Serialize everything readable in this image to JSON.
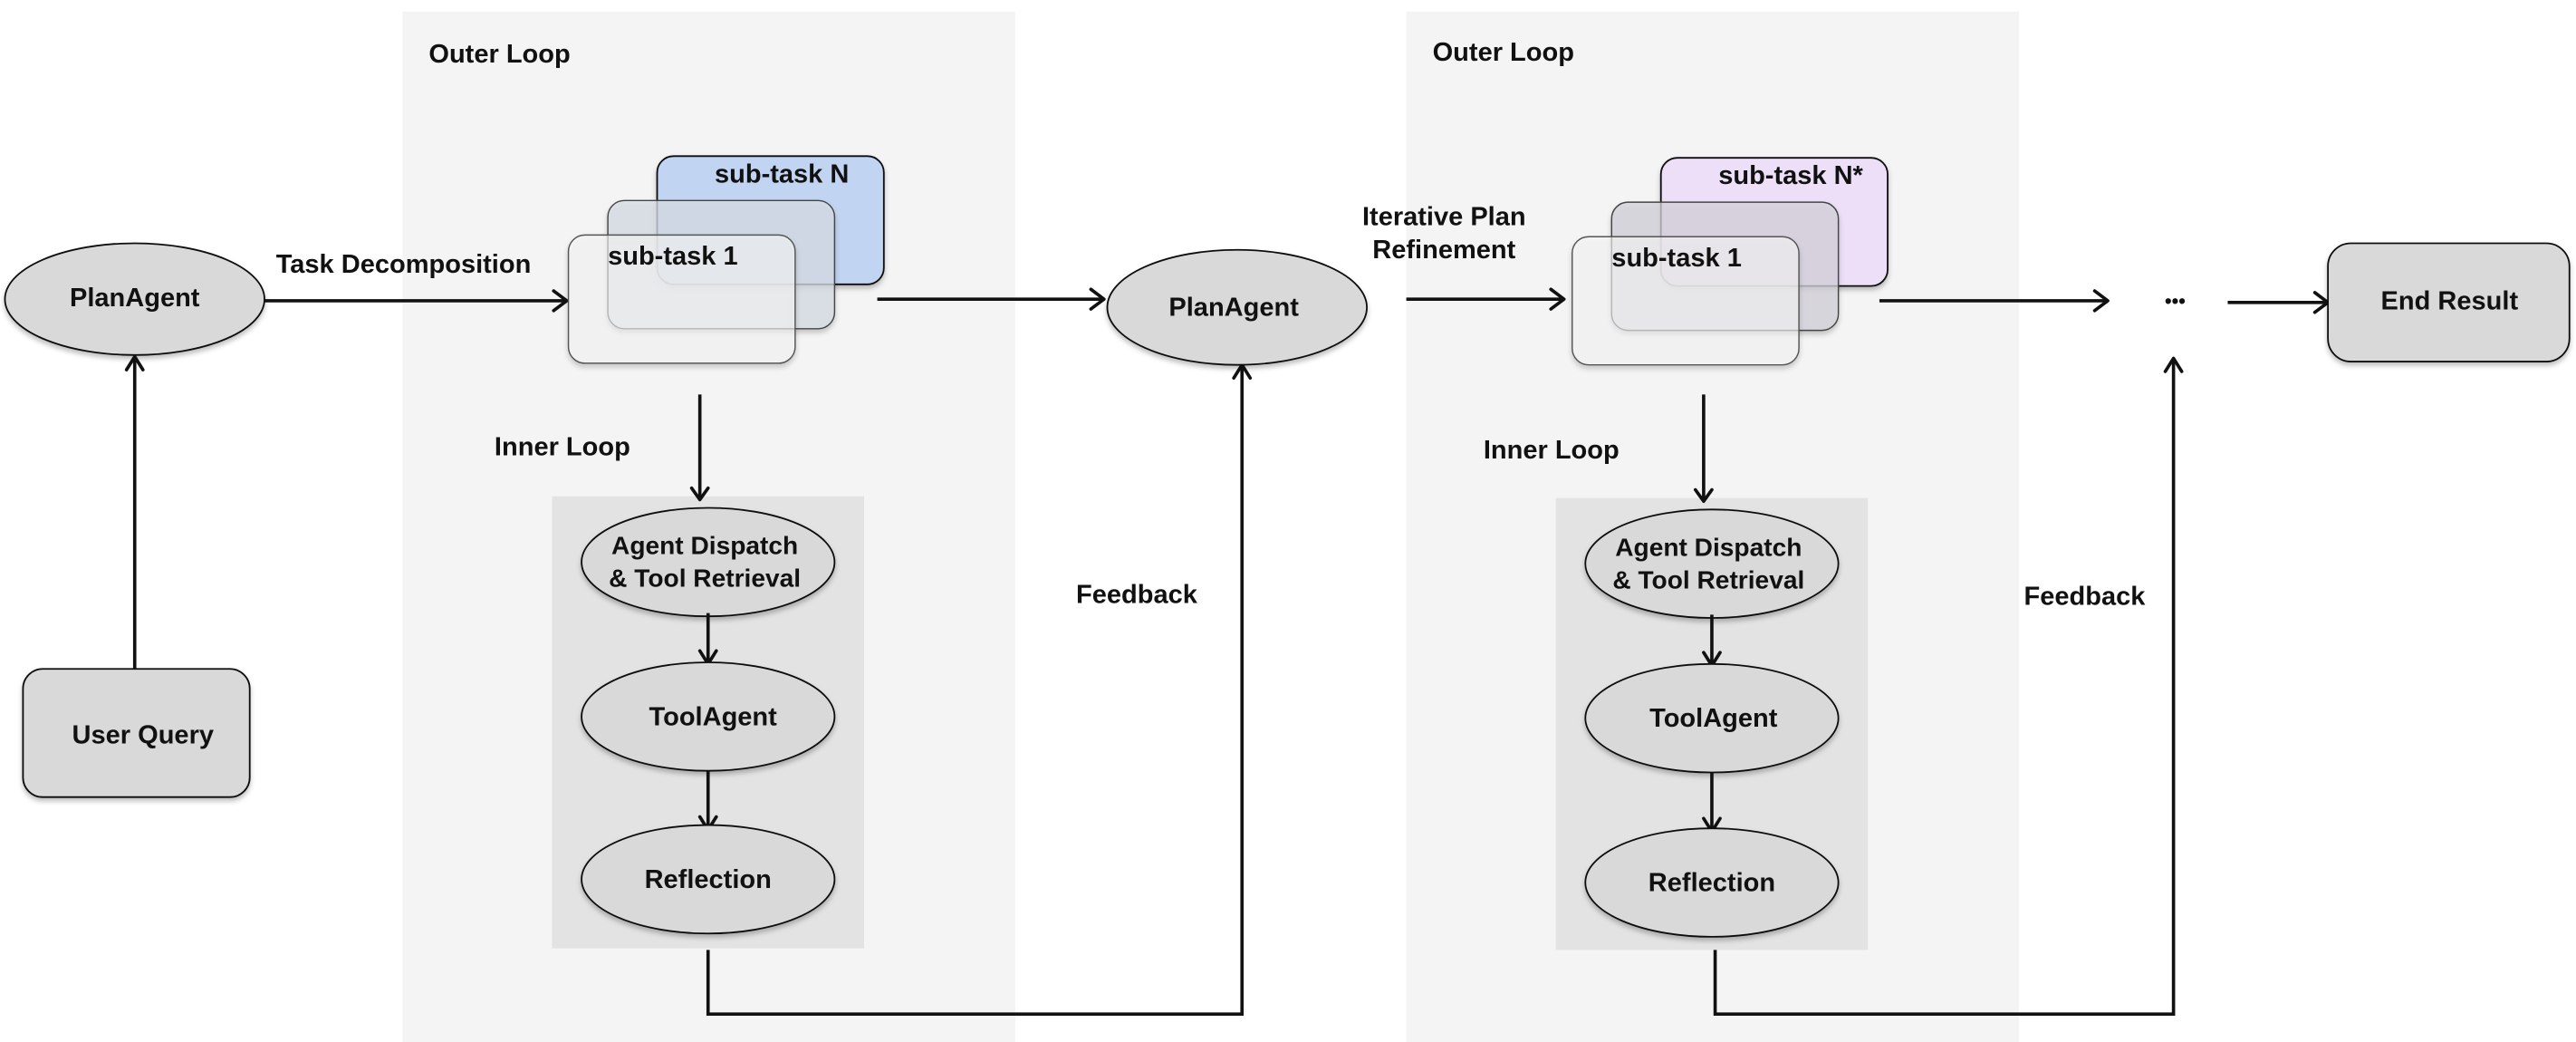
{
  "colors": {
    "outer_loop_bg": "#f4f4f4",
    "inner_loop_bg": "#e3e3e3",
    "node_fill": "#d9d9d9",
    "subtask_front": "#fafafa",
    "subtask_mid": "#d7dde6",
    "subtask_back_left": "#c1d4f1",
    "subtask_back_right": "#ecdff7"
  },
  "left": {
    "plan_agent": "PlanAgent",
    "user_query": "User Query",
    "edge_task_decomposition": "Task Decomposition"
  },
  "outer_loops": [
    {
      "title": "Outer Loop",
      "subtasks": {
        "front": "sub-task 1",
        "back": "sub-task N"
      },
      "inner_loop_title": "Inner Loop",
      "inner_nodes": [
        "Agent Dispatch\n& Tool Retrieval",
        "ToolAgent",
        "Reflection"
      ],
      "feedback_label": "Feedback"
    },
    {
      "title": "Outer Loop",
      "subtasks": {
        "front": "sub-task 1",
        "back": "sub-task N*"
      },
      "inner_loop_title": "Inner Loop",
      "inner_nodes": [
        "Agent Dispatch\n& Tool Retrieval",
        "ToolAgent",
        "Reflection"
      ],
      "feedback_label": "Feedback"
    }
  ],
  "middle": {
    "plan_agent": "PlanAgent",
    "edge_refinement_line1": "Iterative Plan",
    "edge_refinement_line2": "Refinement"
  },
  "right": {
    "ellipsis": "•••",
    "end_result": "End Result"
  },
  "inner_labels": {
    "dispatch_line1": "Agent Dispatch",
    "dispatch_line2": "& Tool Retrieval"
  }
}
